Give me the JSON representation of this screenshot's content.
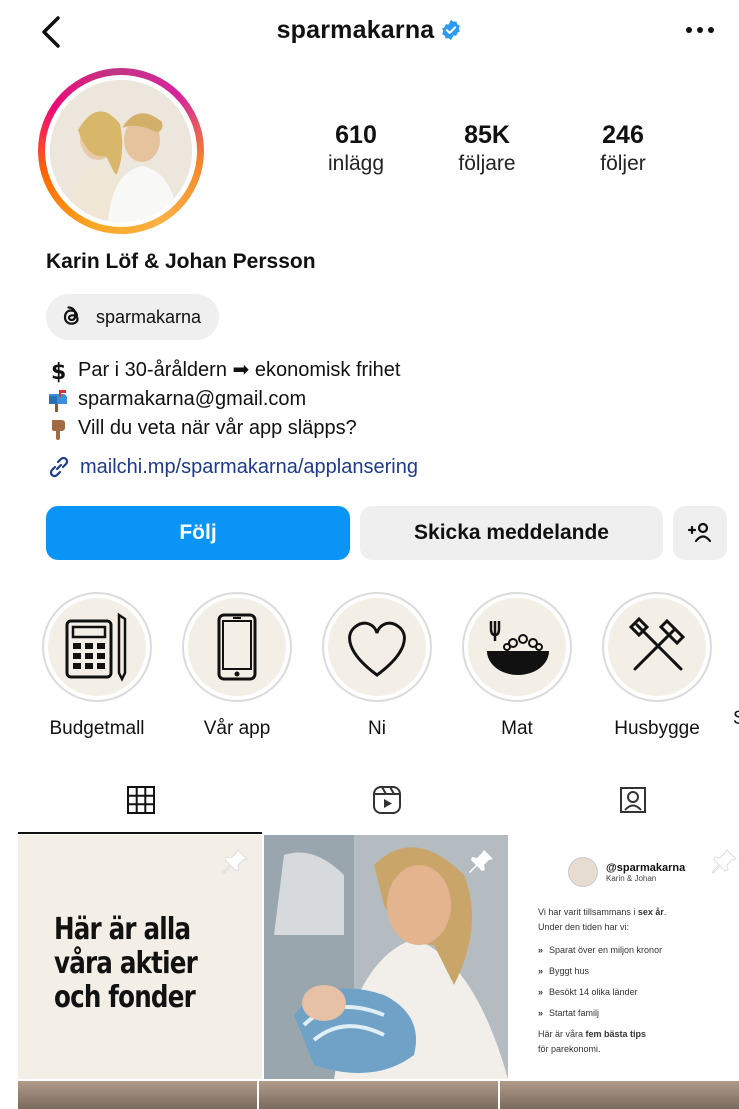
{
  "header": {
    "username": "sparmakarna"
  },
  "profile": {
    "stats": [
      {
        "value": "610",
        "label": "inlägg"
      },
      {
        "value": "85K",
        "label": "följare"
      },
      {
        "value": "246",
        "label": "följer"
      }
    ],
    "name": "Karin Löf & Johan Persson",
    "threads_handle": "sparmakarna",
    "bio": [
      {
        "icon": "dollar-icon",
        "text": "Par i 30-åråldern ➡ ekonomisk frihet"
      },
      {
        "icon": "mailbox-icon",
        "text": "sparmakarna@gmail.com"
      },
      {
        "icon": "pointing-down-icon",
        "text": "Vill du veta när vår app släpps?"
      }
    ],
    "link": "mailchi.mp/sparmakarna/applansering"
  },
  "actions": {
    "follow": "Följ",
    "message": "Skicka meddelande"
  },
  "highlights": [
    {
      "label": "Budgetmall",
      "icon": "calculator-icon"
    },
    {
      "label": "Vår app",
      "icon": "phone-icon"
    },
    {
      "label": "Ni",
      "icon": "heart-icon"
    },
    {
      "label": "Mat",
      "icon": "bowl-icon"
    },
    {
      "label": "Husbygge",
      "icon": "tools-icon"
    },
    {
      "label": "S"
    }
  ],
  "posts": {
    "tile1": {
      "lines": [
        "Här är alla",
        "våra aktier",
        "och fonder"
      ]
    },
    "tile3": {
      "handle": "@sparmakarna",
      "sub": "Karin & Johan",
      "intro_a": "Vi har varit tillsammans i ",
      "intro_bold": "sex år",
      "intro_b": ".",
      "intro2": "Under den tiden har vi:",
      "items": [
        "Sparat över en miljon kronor",
        "Byggt hus",
        "Besökt 14 olika länder",
        "Startat familj"
      ],
      "outro_a": "Här är våra ",
      "outro_bold": "fem bästa tips",
      "outro_b": "för parekonomi."
    }
  }
}
